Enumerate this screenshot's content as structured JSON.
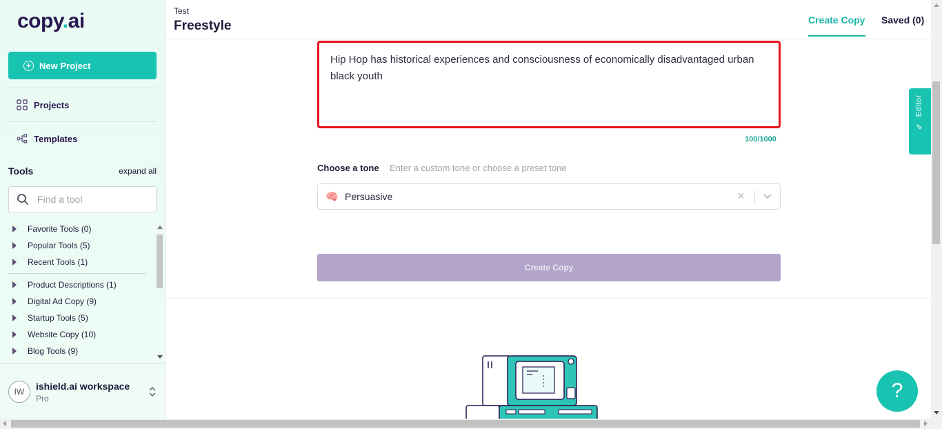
{
  "logo": {
    "part1": "copy",
    "dot": ".",
    "part2": "ai"
  },
  "sidebar": {
    "new_project_label": "New Project",
    "nav": [
      {
        "label": "Projects",
        "icon": "grid-icon"
      },
      {
        "label": "Templates",
        "icon": "share-nodes-icon"
      }
    ],
    "tools_title": "Tools",
    "expand_all": "expand all",
    "search_placeholder": "Find a tool",
    "tool_groups": [
      {
        "label": "Favorite Tools (0)"
      },
      {
        "label": "Popular Tools (5)"
      },
      {
        "label": "Recent Tools (1)"
      },
      {
        "label": "Product Descriptions (1)"
      },
      {
        "label": "Digital Ad Copy (9)"
      },
      {
        "label": "Startup Tools (5)"
      },
      {
        "label": "Website Copy (10)"
      },
      {
        "label": "Blog Tools (9)"
      }
    ],
    "workspace": {
      "initials": "IW",
      "name": "ishield.ai workspace",
      "plan": "Pro"
    }
  },
  "header": {
    "breadcrumb": "Test",
    "title": "Freestyle",
    "tabs": [
      {
        "label": "Create Copy",
        "active": true
      },
      {
        "label": "Saved (0)",
        "active": false
      }
    ]
  },
  "editor": {
    "description": "Hip Hop has historical experiences and consciousness of economically disadvantaged urban black youth",
    "char_count": "100/1000",
    "tone_label": "Choose a tone",
    "tone_hint": "Enter a custom tone or choose a preset tone",
    "tone_value": "Persuasive",
    "tone_emoji": "🧠",
    "create_label": "Create Copy"
  },
  "side_tab": {
    "label": "Editor"
  },
  "help": {
    "label": "?"
  },
  "colors": {
    "accent": "#19c3b1",
    "brand": "#2a1650",
    "highlight": "#e5141c",
    "button_disabled": "#b3a4c9"
  }
}
